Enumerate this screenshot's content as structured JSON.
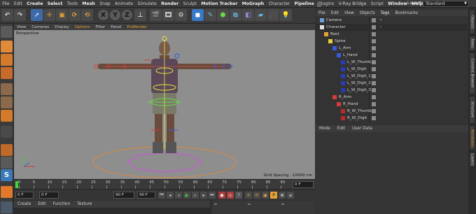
{
  "menubar": {
    "items": [
      "File",
      "Edit",
      "Create",
      "Select",
      "Tools",
      "Mesh",
      "Snap",
      "Animate",
      "Simulate",
      "Render",
      "Sculpt",
      "Motion Tracker",
      "MoGraph",
      "Character",
      "Pipeline",
      "Plugins",
      "V-Ray Bridge",
      "Script",
      "Window",
      "Help"
    ],
    "layout_label": "Layout:",
    "layout_value": "Standard"
  },
  "toolbar": {
    "axis_x": "X",
    "axis_y": "Y",
    "axis_z": "Z"
  },
  "viewport": {
    "menu": [
      "View",
      "Cameras",
      "Display",
      "Options",
      "Filter",
      "Panel",
      "ProRender"
    ],
    "label": "Perspective",
    "grid_spacing": "Grid Spacing : 10000 cm"
  },
  "timeline": {
    "ticks": [
      "0",
      "5",
      "10",
      "15",
      "20",
      "25",
      "30",
      "35",
      "40",
      "45",
      "50",
      "55",
      "60",
      "65",
      "70",
      "75",
      "80",
      "85",
      "90"
    ],
    "end_label": "0 F",
    "current_frame": "0 F",
    "min_frame": "0 F",
    "max_frame": "90 F",
    "total_frame": "90 F"
  },
  "materials": {
    "menu": [
      "Create",
      "Edit",
      "Function",
      "Texture"
    ]
  },
  "objects": {
    "menu": [
      "File",
      "Edit",
      "View",
      "Objects",
      "Tags",
      "Bookmarks"
    ],
    "rows": [
      {
        "label": "Camera",
        "indent": 0,
        "color": "#6aa0d8",
        "check": "✕"
      },
      {
        "label": "Character",
        "indent": 0,
        "color": "#e0e0e0",
        "check": "✓"
      },
      {
        "label": "Root",
        "indent": 1,
        "color": "#e6a13a",
        "check": ""
      },
      {
        "label": "Spine",
        "indent": 2,
        "color": "#e6d03a",
        "check": ""
      },
      {
        "label": "L_Arm",
        "indent": 3,
        "color": "#3a5ad8",
        "check": ""
      },
      {
        "label": "L_Hand",
        "indent": 4,
        "color": "#3a5ad8",
        "check": ""
      },
      {
        "label": "L_W_Thumb",
        "indent": 5,
        "color": "#2a3ab8",
        "check": ""
      },
      {
        "label": "L_W_Digit",
        "indent": 5,
        "color": "#2a3ab8",
        "check": ""
      },
      {
        "label": "L_W_Digit_1",
        "indent": 5,
        "color": "#2a3ab8",
        "check": ""
      },
      {
        "label": "L_W_Digit_2",
        "indent": 5,
        "color": "#2a3ab8",
        "check": ""
      },
      {
        "label": "L_W_Digit_3",
        "indent": 5,
        "color": "#2a3ab8",
        "check": ""
      },
      {
        "label": "R_Arm",
        "indent": 3,
        "color": "#d83a3a",
        "check": ""
      },
      {
        "label": "R_Hand",
        "indent": 4,
        "color": "#d83a3a",
        "check": ""
      },
      {
        "label": "R_W_Thumb",
        "indent": 5,
        "color": "#b82a2a",
        "check": ""
      },
      {
        "label": "R_W_Digit",
        "indent": 5,
        "color": "#b82a2a",
        "check": ""
      }
    ]
  },
  "attributes": {
    "menu": [
      "Mode",
      "Edit",
      "User Data"
    ]
  },
  "right_tabs": [
    "Objects",
    "Takes",
    "Content Browser",
    "Structure",
    "Attributes",
    "Layers"
  ],
  "colors": {
    "accent": "#e6a13a",
    "viewport_bg": "#8e8e8e",
    "panel_bg": "#333333"
  }
}
